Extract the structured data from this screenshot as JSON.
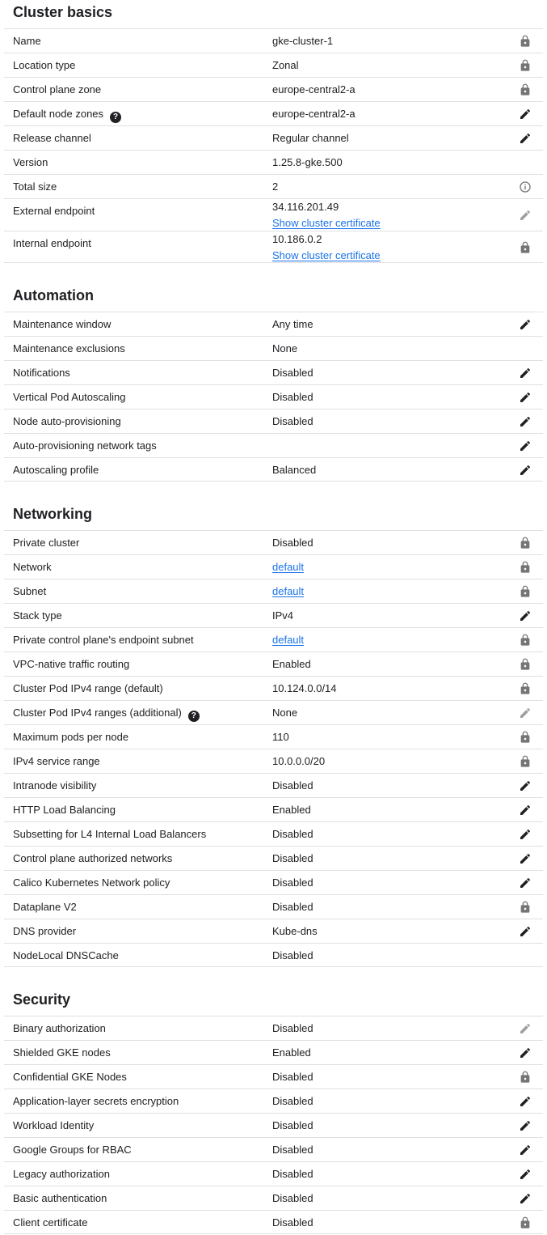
{
  "sections": [
    {
      "title": "Cluster basics",
      "rows": [
        {
          "label": "Name",
          "value": "gke-cluster-1",
          "icon": "lock"
        },
        {
          "label": "Location type",
          "value": "Zonal",
          "icon": "lock"
        },
        {
          "label": "Control plane zone",
          "value": "europe-central2-a",
          "icon": "lock"
        },
        {
          "label": "Default node zones",
          "help": true,
          "value": "europe-central2-a",
          "icon": "edit"
        },
        {
          "label": "Release channel",
          "value": "Regular channel",
          "icon": "edit"
        },
        {
          "label": "Version",
          "value": "1.25.8-gke.500",
          "icon": ""
        },
        {
          "label": "Total size",
          "value": "2",
          "icon": "info"
        },
        {
          "label": "External endpoint",
          "value": "34.116.201.49",
          "link": "Show cluster certificate",
          "icon": "edit-disabled",
          "tall": true
        },
        {
          "label": "Internal endpoint",
          "value": "10.186.0.2",
          "link": "Show cluster certificate",
          "icon": "lock",
          "tall": true
        }
      ]
    },
    {
      "title": "Automation",
      "rows": [
        {
          "label": "Maintenance window",
          "value": "Any time",
          "icon": "edit"
        },
        {
          "label": "Maintenance exclusions",
          "value": "None",
          "icon": ""
        },
        {
          "label": "Notifications",
          "value": "Disabled",
          "icon": "edit"
        },
        {
          "label": "Vertical Pod Autoscaling",
          "value": "Disabled",
          "icon": "edit"
        },
        {
          "label": "Node auto-provisioning",
          "value": "Disabled",
          "icon": "edit"
        },
        {
          "label": "Auto-provisioning network tags",
          "value": "",
          "icon": "edit"
        },
        {
          "label": "Autoscaling profile",
          "value": "Balanced",
          "icon": "edit"
        }
      ]
    },
    {
      "title": "Networking",
      "rows": [
        {
          "label": "Private cluster",
          "value": "Disabled",
          "icon": "lock"
        },
        {
          "label": "Network",
          "value": "default",
          "valueLink": true,
          "icon": "lock"
        },
        {
          "label": "Subnet",
          "value": "default",
          "valueLink": true,
          "icon": "lock"
        },
        {
          "label": "Stack type",
          "value": "IPv4",
          "icon": "edit"
        },
        {
          "label": "Private control plane's endpoint subnet",
          "value": "default",
          "valueLink": true,
          "icon": "lock"
        },
        {
          "label": "VPC-native traffic routing",
          "value": "Enabled",
          "icon": "lock"
        },
        {
          "label": "Cluster Pod IPv4 range (default)",
          "value": "10.124.0.0/14",
          "icon": "lock"
        },
        {
          "label": "Cluster Pod IPv4 ranges (additional)",
          "help": true,
          "value": "None",
          "icon": "edit-disabled"
        },
        {
          "label": "Maximum pods per node",
          "value": "110",
          "icon": "lock"
        },
        {
          "label": "IPv4 service range",
          "value": "10.0.0.0/20",
          "icon": "lock"
        },
        {
          "label": "Intranode visibility",
          "value": "Disabled",
          "icon": "edit"
        },
        {
          "label": "HTTP Load Balancing",
          "value": "Enabled",
          "icon": "edit"
        },
        {
          "label": "Subsetting for L4 Internal Load Balancers",
          "value": "Disabled",
          "icon": "edit"
        },
        {
          "label": "Control plane authorized networks",
          "value": "Disabled",
          "icon": "edit"
        },
        {
          "label": "Calico Kubernetes Network policy",
          "value": "Disabled",
          "icon": "edit"
        },
        {
          "label": "Dataplane V2",
          "value": "Disabled",
          "icon": "lock"
        },
        {
          "label": "DNS provider",
          "value": "Kube-dns",
          "icon": "edit"
        },
        {
          "label": "NodeLocal DNSCache",
          "value": "Disabled",
          "icon": ""
        }
      ]
    },
    {
      "title": "Security",
      "rows": [
        {
          "label": "Binary authorization",
          "value": "Disabled",
          "icon": "edit-disabled"
        },
        {
          "label": "Shielded GKE nodes",
          "value": "Enabled",
          "icon": "edit"
        },
        {
          "label": "Confidential GKE Nodes",
          "value": "Disabled",
          "icon": "lock"
        },
        {
          "label": "Application-layer secrets encryption",
          "value": "Disabled",
          "icon": "edit"
        },
        {
          "label": "Workload Identity",
          "value": "Disabled",
          "icon": "edit"
        },
        {
          "label": "Google Groups for RBAC",
          "value": "Disabled",
          "icon": "edit"
        },
        {
          "label": "Legacy authorization",
          "value": "Disabled",
          "icon": "edit"
        },
        {
          "label": "Basic authentication",
          "value": "Disabled",
          "icon": "edit"
        },
        {
          "label": "Client certificate",
          "value": "Disabled",
          "icon": "lock"
        }
      ]
    }
  ],
  "help_glyph": "?",
  "colors": {
    "text": "#202124",
    "link": "#1a73e8",
    "divider": "#e0e0e0",
    "icon_muted": "#757575",
    "icon_disabled": "#9e9e9e"
  }
}
